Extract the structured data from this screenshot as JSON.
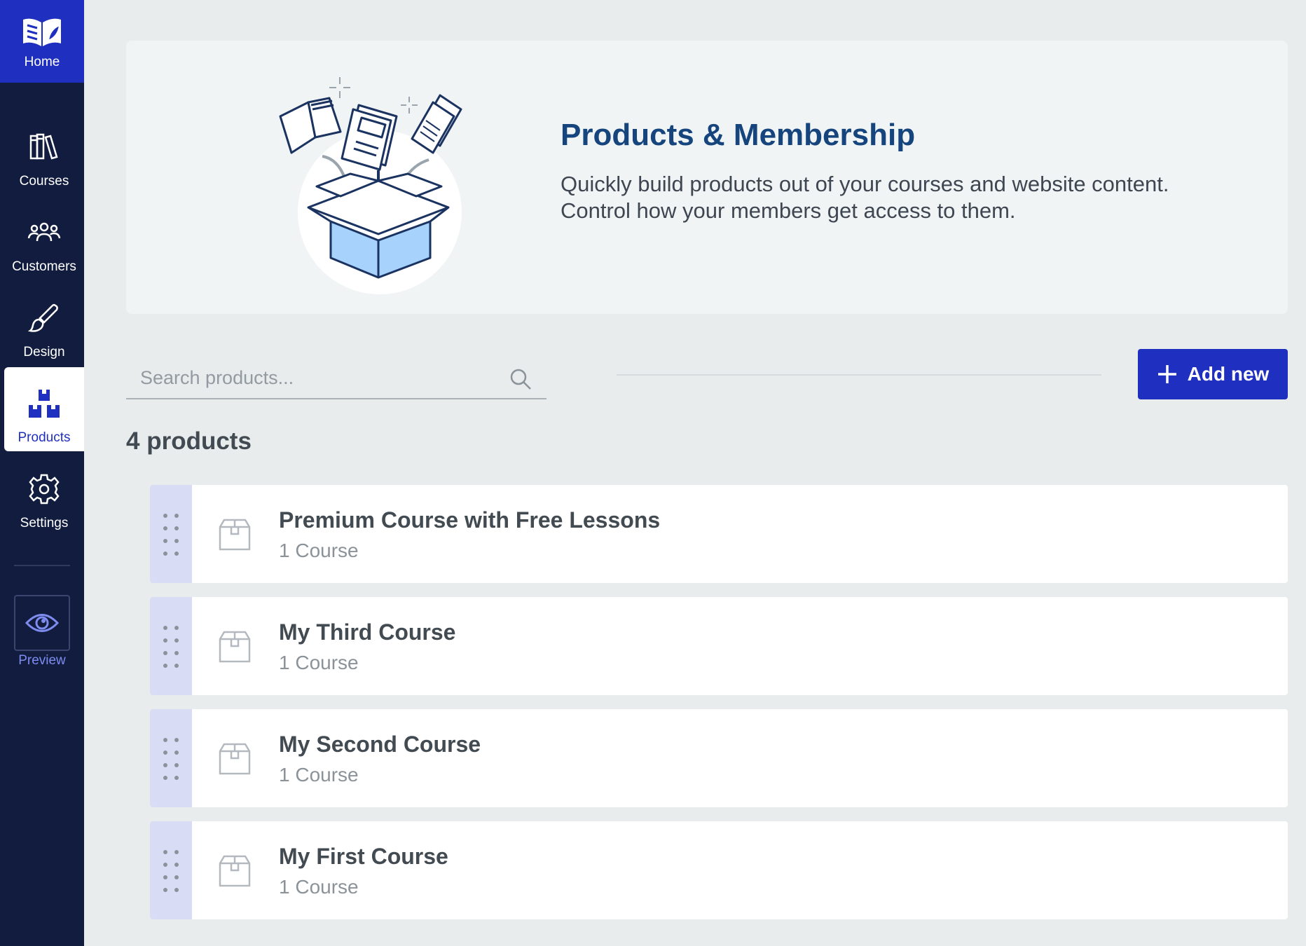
{
  "sidebar": {
    "home_label": "Home",
    "items": [
      {
        "label": "Courses",
        "icon": "books-icon"
      },
      {
        "label": "Customers",
        "icon": "users-icon"
      },
      {
        "label": "Design",
        "icon": "paintbrush-icon"
      },
      {
        "label": "Products",
        "icon": "boxes-icon",
        "active": true
      },
      {
        "label": "Settings",
        "icon": "gear-icon"
      }
    ],
    "preview_label": "Preview"
  },
  "hero": {
    "title": "Products & Membership",
    "description": "Quickly build products out of your courses and website content. Control how your members get access to them."
  },
  "search": {
    "placeholder": "Search products...",
    "value": ""
  },
  "toolbar": {
    "add_label": "Add new"
  },
  "summary": {
    "count_label": "4 products"
  },
  "products": [
    {
      "name": "Premium Course with Free Lessons",
      "meta": "1 Course"
    },
    {
      "name": "My Third Course",
      "meta": "1 Course"
    },
    {
      "name": "My Second Course",
      "meta": "1 Course"
    },
    {
      "name": "My First Course",
      "meta": "1 Course"
    }
  ],
  "colors": {
    "sidebar_bg": "#111c3f",
    "accent": "#1f2fbf",
    "title": "#16457e",
    "page_bg": "#e8eced",
    "drag_handle_bg": "#d9dcf5"
  }
}
